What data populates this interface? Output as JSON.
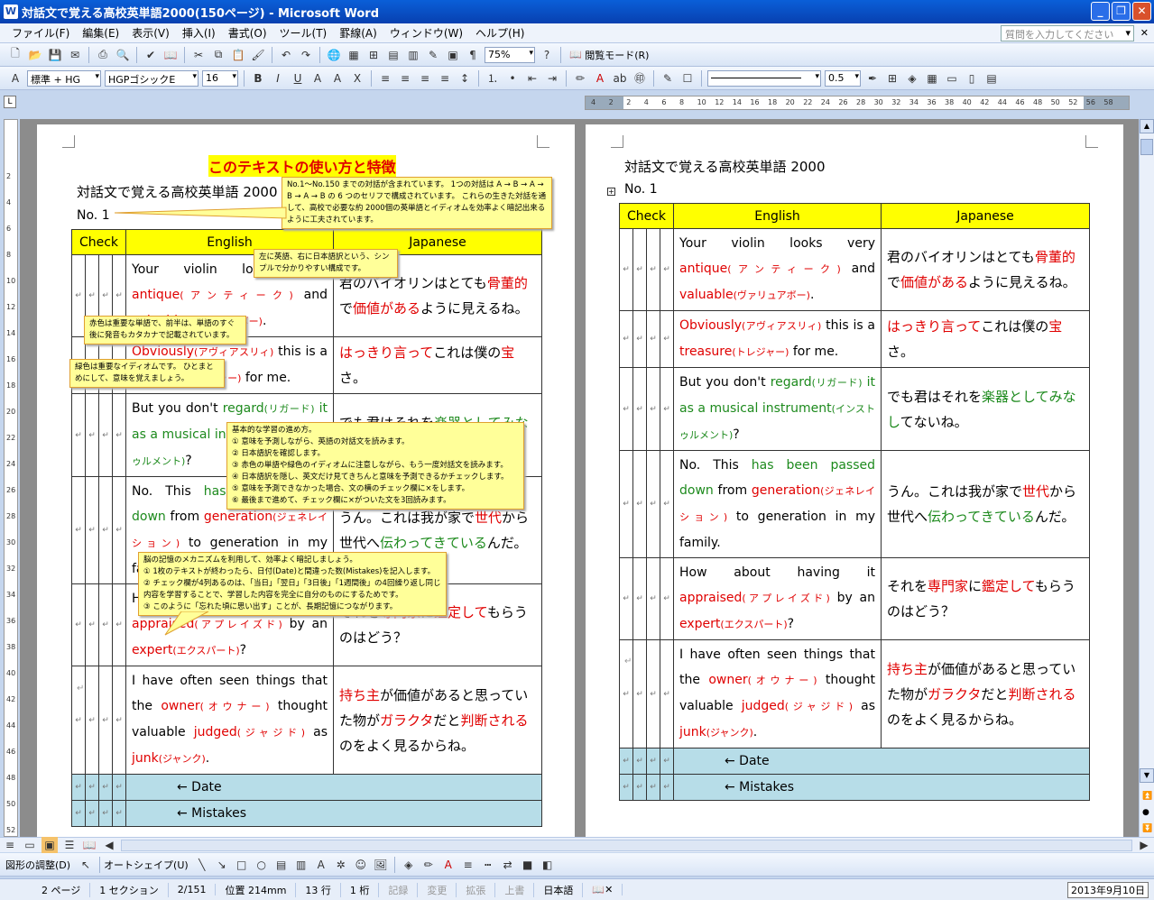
{
  "window": {
    "title": "対話文で覚える高校英単語2000(150ページ) - Microsoft Word"
  },
  "menu": [
    "ファイル(F)",
    "編集(E)",
    "表示(V)",
    "挿入(I)",
    "書式(O)",
    "ツール(T)",
    "罫線(A)",
    "ウィンドウ(W)",
    "ヘルプ(H)"
  ],
  "help_placeholder": "質問を入力してください",
  "toolbar": {
    "zoom": "75%",
    "reading_mode": "閲覧モード(R)",
    "style": "標準 + HG",
    "font": "HGPゴシックE",
    "size": "16",
    "line_weight": "0.5"
  },
  "ruler_numbers": [
    "4",
    "2",
    "2",
    "4",
    "6",
    "8",
    "10",
    "12",
    "14",
    "16",
    "18",
    "20",
    "22",
    "24",
    "26",
    "28",
    "30",
    "32",
    "34",
    "36",
    "38",
    "40",
    "42",
    "44",
    "46",
    "48",
    "50",
    "52",
    "56",
    "58"
  ],
  "vruler_numbers": [
    "2",
    "4",
    "6",
    "8",
    "10",
    "12",
    "14",
    "16",
    "18",
    "20",
    "22",
    "24",
    "26",
    "28",
    "30",
    "32",
    "34",
    "36",
    "38",
    "40",
    "42",
    "44",
    "46",
    "48",
    "50",
    "52"
  ],
  "doc": {
    "heading": "このテキストの使い方と特徴",
    "subtitle": "対話文で覚える高校英単語 2000",
    "no": "No. 1",
    "cols": {
      "check": "Check",
      "english": "English",
      "japanese": "Japanese"
    },
    "rows": [
      {
        "en": [
          [
            "Your violin looks very ",
            ""
          ],
          [
            "antique",
            "r"
          ],
          [
            "(アンティーク)",
            "r sm"
          ],
          [
            " and ",
            ""
          ],
          [
            "valuable",
            "r"
          ],
          [
            "(ヴァリュアボー)",
            "r sm"
          ],
          [
            ".",
            ""
          ]
        ],
        "ja": [
          [
            "君のバイオリンはとても",
            ""
          ],
          [
            "骨董的",
            "r"
          ],
          [
            "で",
            ""
          ],
          [
            "価値がある",
            "r"
          ],
          [
            "ように見えるね。",
            ""
          ]
        ]
      },
      {
        "en": [
          [
            "Obviously",
            "r"
          ],
          [
            "(アヴィアスリィ)",
            "r sm"
          ],
          [
            " this is a ",
            ""
          ],
          [
            "treasure",
            "r"
          ],
          [
            "(トレジャー)",
            "r sm"
          ],
          [
            " for me.",
            ""
          ]
        ],
        "ja": [
          [
            "はっきり言って",
            "r"
          ],
          [
            "これは僕の",
            ""
          ],
          [
            "宝",
            "r"
          ],
          [
            "さ。",
            ""
          ]
        ]
      },
      {
        "en": [
          [
            "But you don't ",
            ""
          ],
          [
            "regard",
            "g"
          ],
          [
            "(リガード)",
            "g sm"
          ],
          [
            " it as a ",
            "g"
          ],
          [
            "musical instrument",
            "g"
          ],
          [
            "(インストゥルメント)",
            "g sm"
          ],
          [
            "?",
            ""
          ]
        ],
        "ja": [
          [
            "でも君はそれを",
            ""
          ],
          [
            "楽器としてみなし",
            "g"
          ],
          [
            "てないね。",
            ""
          ]
        ]
      },
      {
        "en": [
          [
            "No.  This ",
            ""
          ],
          [
            "has been passed down",
            "g"
          ],
          [
            " from ",
            ""
          ],
          [
            "generation",
            "r"
          ],
          [
            "(ジェネレイション)",
            "r sm"
          ],
          [
            " to generation in my family.",
            ""
          ]
        ],
        "ja": [
          [
            "うん。これは我が家で",
            ""
          ],
          [
            "世代",
            "r"
          ],
          [
            "から世代へ",
            ""
          ],
          [
            "伝わってきている",
            "g"
          ],
          [
            "んだ。",
            ""
          ]
        ]
      },
      {
        "en": [
          [
            "How about having it ",
            ""
          ],
          [
            "appraised",
            "r"
          ],
          [
            "(アプレイズド)",
            "r sm"
          ],
          [
            " by an ",
            ""
          ],
          [
            "expert",
            "r"
          ],
          [
            "(エクスパート)",
            "r sm"
          ],
          [
            "?",
            ""
          ]
        ],
        "ja": [
          [
            "それを",
            ""
          ],
          [
            "専門家",
            "r"
          ],
          [
            "に",
            ""
          ],
          [
            "鑑定して",
            "r"
          ],
          [
            "もらうのはどう？",
            ""
          ]
        ]
      },
      {
        "en": [
          [
            "I have often seen things that the ",
            ""
          ],
          [
            "owner",
            "r"
          ],
          [
            "(オウナー)",
            "r sm"
          ],
          [
            " thought valuable ",
            ""
          ],
          [
            "judged",
            "r"
          ],
          [
            "(ジャジド)",
            "r sm"
          ],
          [
            " as ",
            ""
          ],
          [
            "junk",
            "r"
          ],
          [
            "(ジャンク)",
            "r sm"
          ],
          [
            ".",
            ""
          ]
        ],
        "ja": [
          [
            "持ち主",
            "r"
          ],
          [
            "が価値があると思っていた物が",
            ""
          ],
          [
            "ガラクタ",
            "r"
          ],
          [
            "だと",
            ""
          ],
          [
            "判断される",
            "r"
          ],
          [
            "のをよく見るからね。",
            ""
          ]
        ]
      }
    ],
    "date_label": "←  Date",
    "mistakes_label": "←  Mistakes"
  },
  "callouts": {
    "c1": "No.1～No.150 までの対話が含まれています。 1つの対話は A → B → A → B → A → B の 6 つのセリフで構成されています。 これらの生きた対話を通して、高校で必要な約 2000個の英単語とイディオムを効率よく暗記出来るように工夫されています。",
    "c2": "左に英語、右に日本語訳という、シンプルで分かりやすい構成です。",
    "c3": "赤色は重要な単語で、前半は、単語のすぐ後に発音もカタカナで記載されています。",
    "c4": "緑色は重要なイディオムです。 ひとまとめにして、意味を覚えましょう。",
    "c5_title": "基本的な学習の進め方。",
    "c5": [
      "① 意味を予測しながら、英語の対話文を読みます。",
      "② 日本語訳を確認します。",
      "③ 赤色の単語や緑色のイディオムに注意しながら、もう一度対話文を読みます。",
      "④ 日本語訳を隠し、英文だけ見てきちんと意味を予測できるかチェックします。",
      "⑤ 意味を予測できなかった場合、文の横のチェック欄に×をします。",
      "⑥ 最後まで進めて、チェック欄に×がついた文を3回読みます。"
    ],
    "c6_title": "脳の記憶のメカニズムを利用して、効率よく暗記しましょう。",
    "c6": [
      "① 1枚のテキストが終わったら、日付(Date)と間違った数(Mistakes)を記入します。",
      "② チェック欄が4列あるのは、「当日」「翌日」「3日後」「1週間後」の4回繰り返し同じ内容を学習することで、学習した内容を完全に自分のものにするためです。",
      "③ このように「忘れた頃に思い出す」ことが、長期記憶につながります。"
    ]
  },
  "drawbar": {
    "adjust": "図形の調整(D)",
    "autoshape": "オートシェイプ(U)"
  },
  "status": {
    "page": "2 ページ",
    "section": "1 セクション",
    "pos": "2/151",
    "at": "位置 214mm",
    "line": "13 行",
    "col": "1 桁",
    "rec": "記録",
    "trk": "変更",
    "ext": "拡張",
    "ovr": "上書",
    "lang": "日本語",
    "date": "2013年9月10日"
  },
  "colors": {
    "title_bar": "#0a5fd8",
    "header_fill": "#ffff00",
    "blue_row": "#b7dde8",
    "red": "#e00000",
    "green": "#1d8a1d"
  }
}
